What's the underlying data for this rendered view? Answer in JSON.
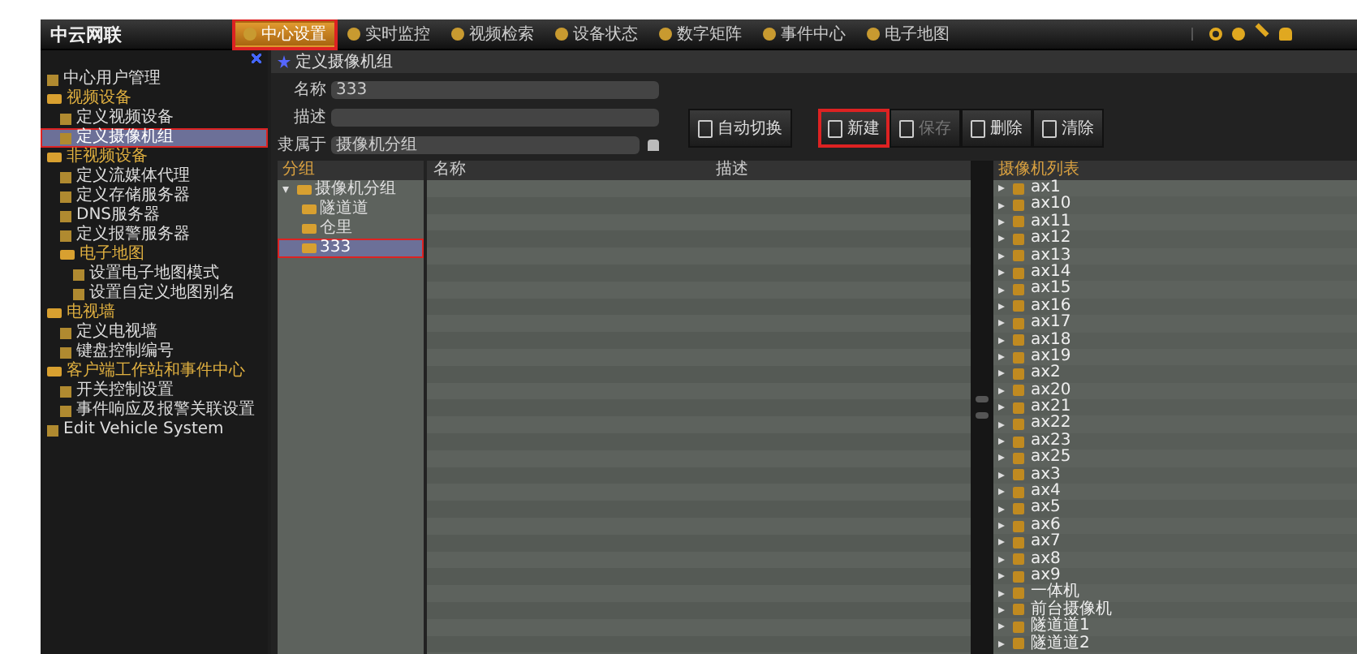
{
  "header": {
    "logo": "中云网联",
    "nav": [
      {
        "label": "中心设置",
        "selected": true,
        "highlighted": true
      },
      {
        "label": "实时监控",
        "selected": false,
        "highlighted": false
      },
      {
        "label": "视频检索",
        "selected": false,
        "highlighted": false
      },
      {
        "label": "设备状态",
        "selected": false,
        "highlighted": false
      },
      {
        "label": "数字矩阵",
        "selected": false,
        "highlighted": false
      },
      {
        "label": "事件中心",
        "selected": false,
        "highlighted": false
      },
      {
        "label": "电子地图",
        "selected": false,
        "highlighted": false
      }
    ]
  },
  "sidebar": {
    "items": [
      {
        "label": "中心用户管理",
        "selected": false,
        "highlighted": false
      },
      {
        "label": "视频设备",
        "selected": false,
        "highlighted": false,
        "expanded": true,
        "children": [
          {
            "label": "定义视频设备",
            "selected": false,
            "highlighted": false
          },
          {
            "label": "定义摄像机组",
            "selected": true,
            "highlighted": true
          }
        ]
      },
      {
        "label": "非视频设备",
        "selected": false,
        "highlighted": false,
        "expanded": true,
        "children": [
          {
            "label": "定义流媒体代理",
            "selected": false,
            "highlighted": false
          },
          {
            "label": "定义存储服务器",
            "selected": false,
            "highlighted": false
          },
          {
            "label": "DNS服务器",
            "selected": false,
            "highlighted": false
          },
          {
            "label": "定义报警服务器",
            "selected": false,
            "highlighted": false
          },
          {
            "label": "电子地图",
            "selected": false,
            "highlighted": false,
            "expanded": true,
            "children": [
              {
                "label": "设置电子地图模式",
                "selected": false,
                "highlighted": false
              },
              {
                "label": "设置自定义地图别名",
                "selected": false,
                "highlighted": false
              }
            ]
          }
        ]
      },
      {
        "label": "电视墙",
        "selected": false,
        "highlighted": false,
        "expanded": true,
        "children": [
          {
            "label": "定义电视墙",
            "selected": false,
            "highlighted": false
          },
          {
            "label": "键盘控制编号",
            "selected": false,
            "highlighted": false
          }
        ]
      },
      {
        "label": "客户端工作站和事件中心",
        "selected": false,
        "highlighted": false,
        "expanded": true,
        "children": [
          {
            "label": "开关控制设置",
            "selected": false,
            "highlighted": false
          },
          {
            "label": "事件响应及报警关联设置",
            "selected": false,
            "highlighted": false
          }
        ]
      },
      {
        "label": "Edit Vehicle System",
        "selected": false,
        "highlighted": false
      }
    ]
  },
  "panel": {
    "title": "定义摄像机组",
    "fields": [
      {
        "label": "名称",
        "value": "333"
      },
      {
        "label": "描述"
      },
      {
        "label": "隶属于",
        "value": "摄像机分组"
      }
    ],
    "buttons": [
      {
        "label": "自动切换",
        "disabled": false,
        "highlighted": false
      },
      {
        "label": "新建",
        "disabled": false,
        "highlighted": true
      },
      {
        "label": "保存",
        "disabled": true,
        "highlighted": false
      },
      {
        "label": "删除",
        "disabled": false,
        "highlighted": false
      },
      {
        "label": "清除",
        "disabled": false,
        "highlighted": false
      }
    ]
  },
  "tree": {
    "header": "分组",
    "items": [
      {
        "label": "摄像机分组",
        "expanded": true,
        "selected": false,
        "highlighted": false,
        "children": [
          {
            "label": "隧道道",
            "selected": false,
            "highlighted": false
          },
          {
            "label": "仓里",
            "selected": false,
            "highlighted": false
          },
          {
            "label": "333",
            "selected": true,
            "highlighted": true
          }
        ]
      }
    ]
  },
  "grid": {
    "columns": [
      "名称",
      "描述"
    ]
  },
  "camera_list": {
    "header": "摄像机列表",
    "items": [
      "ax1",
      "ax10",
      "ax11",
      "ax12",
      "ax13",
      "ax14",
      "ax15",
      "ax16",
      "ax17",
      "ax18",
      "ax19",
      "ax2",
      "ax20",
      "ax21",
      "ax22",
      "ax23",
      "ax25",
      "ax3",
      "ax4",
      "ax5",
      "ax6",
      "ax7",
      "ax8",
      "ax9",
      "一体机",
      "前台摄像机",
      "隧道道1",
      "隧道道2"
    ]
  }
}
